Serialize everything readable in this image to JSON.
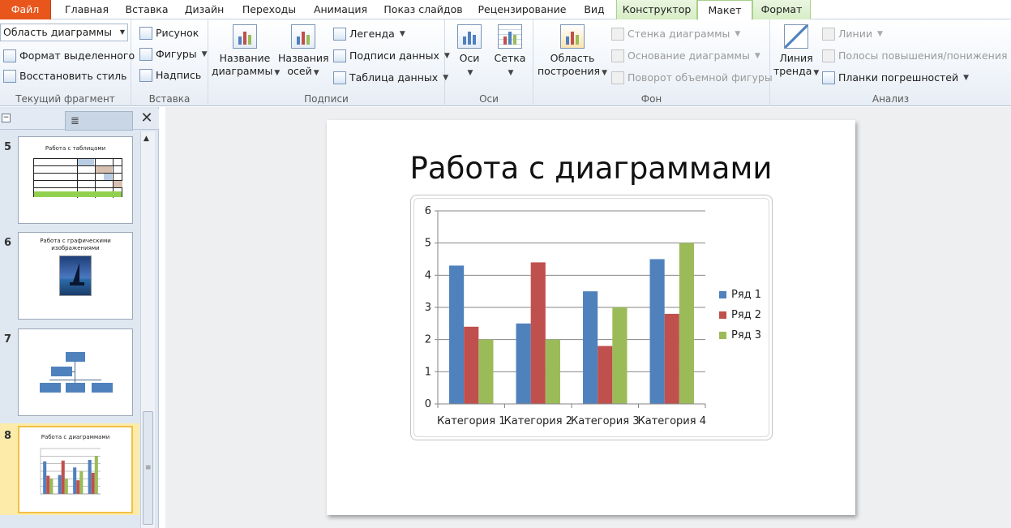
{
  "tabs": [
    "Файл",
    "Главная",
    "Вставка",
    "Дизайн",
    "Переходы",
    "Анимация",
    "Показ слайдов",
    "Рецензирование",
    "Вид",
    "Конструктор",
    "Макет",
    "Формат"
  ],
  "ribbon": {
    "current_fragment": {
      "selector_value": "Область диаграммы",
      "format_selection": "Формат выделенного",
      "reset_style": "Восстановить стиль",
      "label": "Текущий фрагмент"
    },
    "insert": {
      "picture": "Рисунок",
      "shapes": "Фигуры",
      "textbox": "Надпись",
      "label": "Вставка"
    },
    "labels": {
      "chart_title_l1": "Название",
      "chart_title_l2": "диаграммы",
      "axis_titles_l1": "Названия",
      "axis_titles_l2": "осей",
      "legend": "Легенда",
      "data_labels": "Подписи данных",
      "data_table": "Таблица данных",
      "label": "Подписи"
    },
    "axes": {
      "axes": "Оси",
      "gridlines": "Сетка",
      "label": "Оси"
    },
    "background": {
      "plot_area_l1": "Область",
      "plot_area_l2": "построения",
      "chart_wall": "Стенка диаграммы",
      "chart_floor": "Основание диаграммы",
      "rotation_3d": "Поворот объемной фигуры",
      "label": "Фон"
    },
    "analysis": {
      "trendline_l1": "Линия",
      "trendline_l2": "тренда",
      "lines": "Линии",
      "updown_bars": "Полосы повышения/понижения",
      "error_bars": "Планки погрешностей",
      "label": "Анализ"
    }
  },
  "slides_panel": {
    "slides": [
      {
        "number": "5",
        "title": "Работа с таблицами"
      },
      {
        "number": "6",
        "title_l1": "Работа с графическими",
        "title_l2": "изображениями"
      },
      {
        "number": "7"
      },
      {
        "number": "8",
        "title": "Работа с диаграммами"
      }
    ]
  },
  "slide": {
    "title": "Работа с диаграммами"
  },
  "colors": {
    "series1": "#4f81bd",
    "series2": "#c0504d",
    "series3": "#9bbb59",
    "file_tab": "#e8561c"
  },
  "chart_data": {
    "type": "bar",
    "categories": [
      "Категория 1",
      "Категория 2",
      "Категория 3",
      "Категория 4"
    ],
    "series": [
      {
        "name": "Ряд 1",
        "values": [
          4.3,
          2.5,
          3.5,
          4.5
        ]
      },
      {
        "name": "Ряд 2",
        "values": [
          2.4,
          4.4,
          1.8,
          2.8
        ]
      },
      {
        "name": "Ряд 3",
        "values": [
          2,
          2,
          3,
          5
        ]
      }
    ],
    "yticks": [
      "0",
      "1",
      "2",
      "3",
      "4",
      "5",
      "6"
    ],
    "ylim": [
      0,
      6
    ],
    "grid": true,
    "legend": "right"
  }
}
